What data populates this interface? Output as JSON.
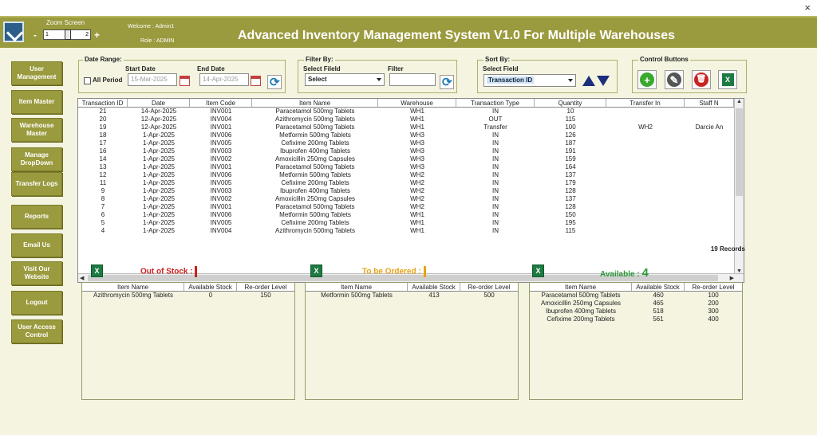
{
  "header": {
    "zoom_label": "Zoom Screen",
    "zoom_minus": "-",
    "zoom_plus": "+",
    "zoom_low": "1",
    "zoom_high": "2",
    "welcome": "Welcome :   Admin1",
    "role": "Role :   ADMIN",
    "title": "Advanced Inventory Management System V1.0  For Multiple Warehouses",
    "window_close": "×"
  },
  "sidebar": {
    "items": [
      {
        "label": "User Management"
      },
      {
        "label": "Item Master"
      },
      {
        "label": "Warehouse Master"
      },
      {
        "label": "Manage DropDown"
      },
      {
        "label": "Transfer Logs"
      },
      {
        "label": "Reports"
      },
      {
        "label": "Email Us"
      },
      {
        "label": "Visit Our Website"
      },
      {
        "label": "Logout"
      },
      {
        "label": "User Access Control"
      }
    ]
  },
  "date_range": {
    "title": "Date Range:",
    "start_label": "Start Date",
    "end_label": "End Date",
    "all_period": "All Period",
    "start_value": "15-Mar-2025",
    "end_value": "14-Apr-2025"
  },
  "filter_by": {
    "title": "Filter By:",
    "select_field_label": "Select Fileld",
    "filter_label": "Filter",
    "select_value": "Select",
    "filter_value": ""
  },
  "sort_by": {
    "title": "Sort By:",
    "select_field_label": "Select Field",
    "select_value": "Transaction ID"
  },
  "control_buttons": {
    "title": "Control Buttons",
    "excel_glyph": "X"
  },
  "grid": {
    "columns": [
      "Transaction ID",
      "Date",
      "Item Code",
      "Item Name",
      "Warehouse",
      "Transaction Type",
      "Quantity",
      "Transfer In",
      "Staff N"
    ],
    "rows": [
      [
        "21",
        "14-Apr-2025",
        "INV001",
        "Paracetamol 500mg Tablets",
        "WH1",
        "IN",
        "10",
        "",
        ""
      ],
      [
        "20",
        "12-Apr-2025",
        "INV004",
        "Azithromycin 500mg Tablets",
        "WH1",
        "OUT",
        "115",
        "",
        ""
      ],
      [
        "19",
        "12-Apr-2025",
        "INV001",
        "Paracetamol 500mg Tablets",
        "WH1",
        "Transfer",
        "100",
        "WH2",
        "Darcie An"
      ],
      [
        "18",
        "1-Apr-2025",
        "INV006",
        "Metformin 500mg Tablets",
        "WH3",
        "IN",
        "126",
        "",
        ""
      ],
      [
        "17",
        "1-Apr-2025",
        "INV005",
        "Cefixime 200mg Tablets",
        "WH3",
        "IN",
        "187",
        "",
        ""
      ],
      [
        "16",
        "1-Apr-2025",
        "INV003",
        "Ibuprofen 400mg Tablets",
        "WH3",
        "IN",
        "191",
        "",
        ""
      ],
      [
        "14",
        "1-Apr-2025",
        "INV002",
        "Amoxicillin 250mg Capsules",
        "WH3",
        "IN",
        "159",
        "",
        ""
      ],
      [
        "13",
        "1-Apr-2025",
        "INV001",
        "Paracetamol 500mg Tablets",
        "WH3",
        "IN",
        "164",
        "",
        ""
      ],
      [
        "12",
        "1-Apr-2025",
        "INV006",
        "Metformin 500mg Tablets",
        "WH2",
        "IN",
        "137",
        "",
        ""
      ],
      [
        "11",
        "1-Apr-2025",
        "INV005",
        "Cefixime 200mg Tablets",
        "WH2",
        "IN",
        "179",
        "",
        ""
      ],
      [
        "9",
        "1-Apr-2025",
        "INV003",
        "Ibuprofen 400mg Tablets",
        "WH2",
        "IN",
        "128",
        "",
        ""
      ],
      [
        "8",
        "1-Apr-2025",
        "INV002",
        "Amoxicillin 250mg Capsules",
        "WH2",
        "IN",
        "137",
        "",
        ""
      ],
      [
        "7",
        "1-Apr-2025",
        "INV001",
        "Paracetamol 500mg Tablets",
        "WH2",
        "IN",
        "128",
        "",
        ""
      ],
      [
        "6",
        "1-Apr-2025",
        "INV006",
        "Metformin 500mg Tablets",
        "WH1",
        "IN",
        "150",
        "",
        ""
      ],
      [
        "5",
        "1-Apr-2025",
        "INV005",
        "Cefixime 200mg Tablets",
        "WH1",
        "IN",
        "195",
        "",
        ""
      ],
      [
        "4",
        "1-Apr-2025",
        "INV004",
        "Azithromycin 500mg Tablets",
        "WH1",
        "IN",
        "115",
        "",
        ""
      ]
    ],
    "records": "19 Records"
  },
  "stock": {
    "columns": [
      "Item Name",
      "Available Stock",
      "Re-order Level"
    ],
    "out_of_stock": {
      "title": "Out of Stock :",
      "count": "1",
      "color": "#cc1f1f",
      "rows": [
        [
          "Azithromycin 500mg Tablets",
          "0",
          "150"
        ]
      ]
    },
    "to_be_ordered": {
      "title": "To be Ordered :",
      "count": "1",
      "color": "#e8a317",
      "rows": [
        [
          "Metformin 500mg Tablets",
          "413",
          "500"
        ]
      ]
    },
    "available": {
      "title": "Available :",
      "count": "4",
      "color": "#2e9a3a",
      "rows": [
        [
          "Paracetamol 500mg Tablets",
          "460",
          "100"
        ],
        [
          "Amoxicillin 250mg Capsules",
          "465",
          "200"
        ],
        [
          "Ibuprofen 400mg Tablets",
          "518",
          "300"
        ],
        [
          "Cefixime 200mg Tablets",
          "561",
          "400"
        ]
      ]
    }
  },
  "colors": {
    "header_bg": "#9a9a3e",
    "panel_bg": "#f4f4e1"
  }
}
